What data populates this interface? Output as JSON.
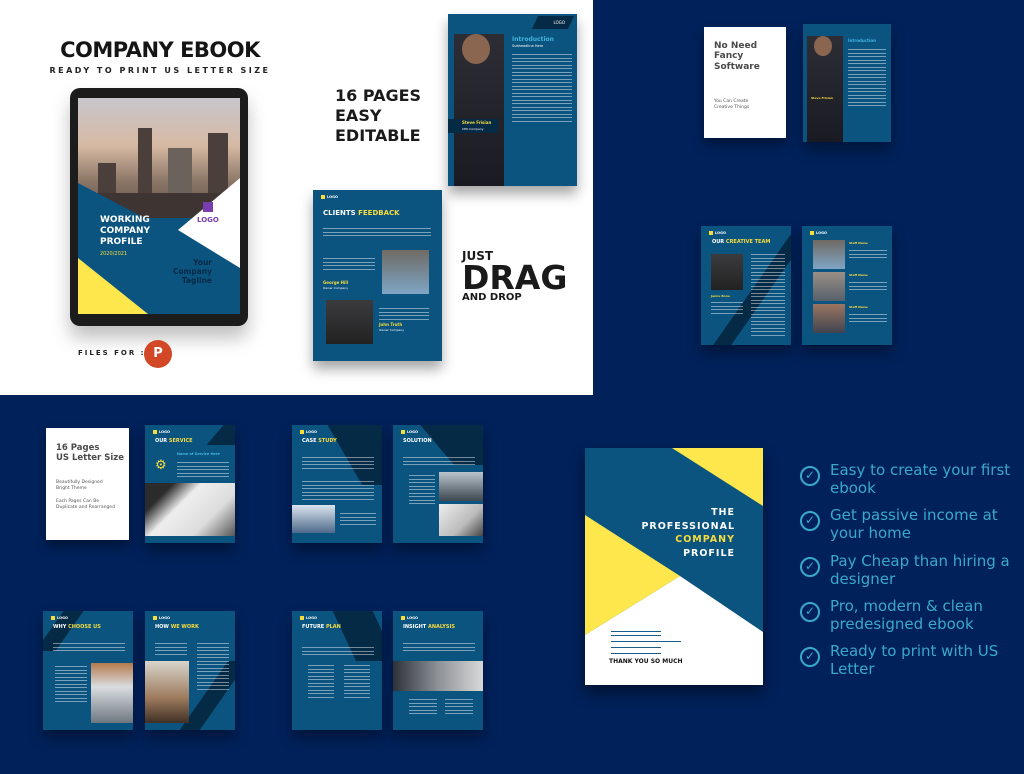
{
  "left_panel": {
    "title": "COMPANY EBOOK",
    "subtitle": "READY TO PRINT US LETTER SIZE",
    "files_for": "FILES FOR :",
    "powerpoint_icon": "powerpoint-icon",
    "tablet_cover": {
      "title_lines": [
        "WORKING",
        "COMPANY",
        "PROFILE"
      ],
      "year": "2020/2021",
      "logo": "LOGO",
      "tagline_lines": [
        "Your",
        "Company",
        "Tagline"
      ]
    }
  },
  "promo": {
    "pages_lines": [
      "16 PAGES",
      "EASY",
      "EDITABLE"
    ],
    "drag_lines": [
      "JUST",
      "DRAG",
      "AND DROP"
    ]
  },
  "pages": {
    "logo": "LOGO",
    "intro": {
      "title": "Introduction",
      "subtitle": "Subheadline Here",
      "person": "Steve Frisian",
      "role": "CEO Company"
    },
    "feedback": {
      "title_a": "CLIENTS ",
      "title_b": "FEEDBACK",
      "person1": "George Hill",
      "role1": "Owner Company",
      "person2": "John Truth",
      "role2": "Owner Company"
    },
    "team": {
      "title_a": "OUR ",
      "title_b": "CREATIVE TEAM",
      "person": "Jamie Bone",
      "staff": "Staff Name"
    },
    "service": {
      "title_a": "OUR ",
      "title_b": "SERVICE",
      "sub": "Name of Service Here"
    },
    "case": {
      "title_a": "CASE ",
      "title_b": "STUDY"
    },
    "solution": {
      "title_a": "SOLUTION",
      "title_b": ""
    },
    "why": {
      "title_a": "WHY ",
      "title_b": "CHOOSE US"
    },
    "how": {
      "title_a": "HOW ",
      "title_b": "WE WORK"
    },
    "future": {
      "title_a": "FUTURE ",
      "title_b": "PLAN"
    },
    "insight": {
      "title_a": "INSIGHT ",
      "title_b": "ANALYSIS"
    }
  },
  "cards": {
    "software": {
      "title_lines": [
        "No Need",
        "Fancy",
        "Software"
      ],
      "sub_lines": [
        "You Can Create",
        "Creative Things"
      ]
    },
    "size": {
      "title_lines": [
        "16 Pages",
        "US Letter Size"
      ],
      "sub_lines": [
        "Beautifully Designed",
        "Bright Theme",
        "",
        "Each Pages Can Be",
        "Duplicate and Rearranged"
      ]
    }
  },
  "back_cover": {
    "title_lines": [
      "THE",
      "PROFESSIONAL",
      "COMPANY",
      "PROFILE"
    ],
    "thanks": "THANK YOU SO MUCH"
  },
  "features": [
    "Easy to create your first ebook",
    "Get passive income at your home",
    "Pay Cheap than hiring a designer",
    "Pro, modern & clean predesigned ebook",
    "Ready to print with US Letter"
  ],
  "colors": {
    "background": "#01215a",
    "page_blue": "#0b5480",
    "yellow": "#f7dc3e",
    "check": "#3aa9c9"
  }
}
